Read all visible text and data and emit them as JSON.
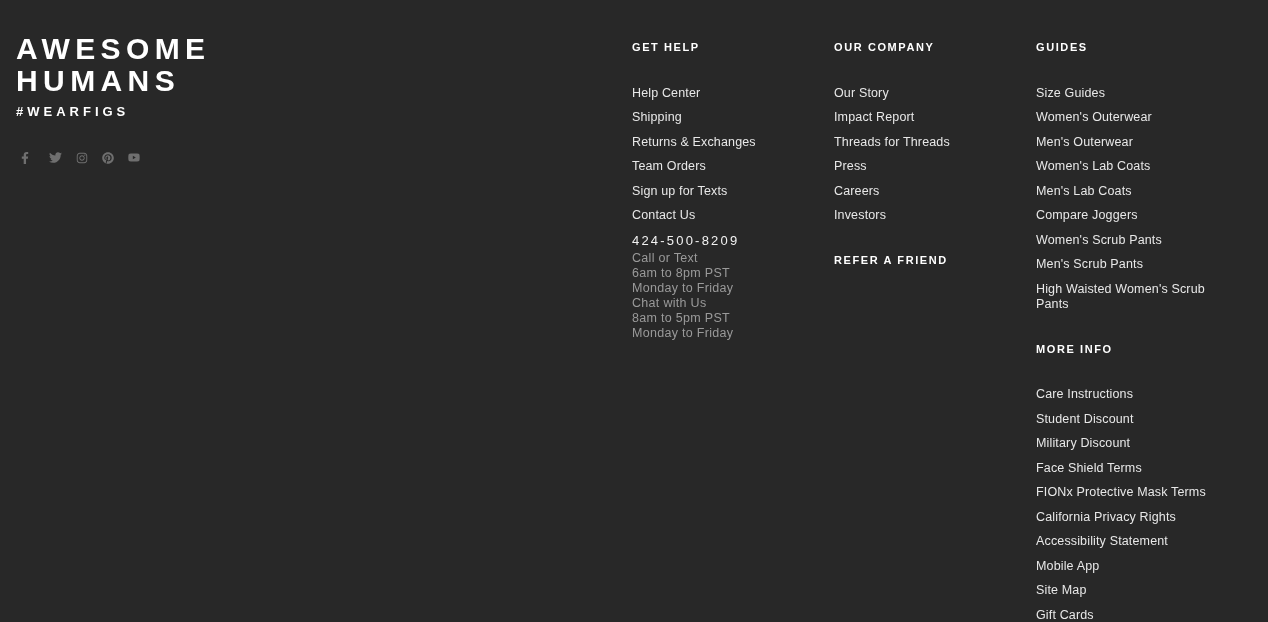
{
  "brand": {
    "title": "AWESOME HUMANS",
    "hashtag": "#WEARFIGS"
  },
  "columns": [
    {
      "sections": [
        {
          "heading": "GET HELP",
          "links": [
            "Help Center",
            "Shipping",
            "Returns & Exchanges",
            "Team Orders",
            "Sign up for Texts",
            "Contact Us"
          ],
          "phone": "424-500-8209",
          "hours": [
            "Call or Text",
            "6am to 8pm PST",
            "Monday to Friday",
            "Chat with Us",
            "8am to 5pm PST",
            "Monday to Friday"
          ]
        }
      ]
    },
    {
      "sections": [
        {
          "heading": "OUR COMPANY",
          "links": [
            "Our Story",
            "Impact Report",
            "Threads for Threads",
            "Press",
            "Careers",
            "Investors"
          ]
        },
        {
          "heading": "REFER A FRIEND"
        }
      ]
    },
    {
      "sections": [
        {
          "heading": "GUIDES",
          "links": [
            "Size Guides",
            "Women's Outerwear",
            "Men's Outerwear",
            "Women's Lab Coats",
            "Men's Lab Coats",
            "Compare Joggers",
            "Women's Scrub Pants",
            "Men's Scrub Pants",
            "High Waisted Women's Scrub Pants"
          ]
        },
        {
          "heading": "MORE INFO",
          "links": [
            "Care Instructions",
            "Student Discount",
            "Military Discount",
            "Face Shield Terms",
            "FIONx Protective Mask Terms",
            "California Privacy Rights",
            "Accessibility Statement",
            "Mobile App",
            "Site Map",
            "Gift Cards"
          ]
        }
      ]
    }
  ]
}
